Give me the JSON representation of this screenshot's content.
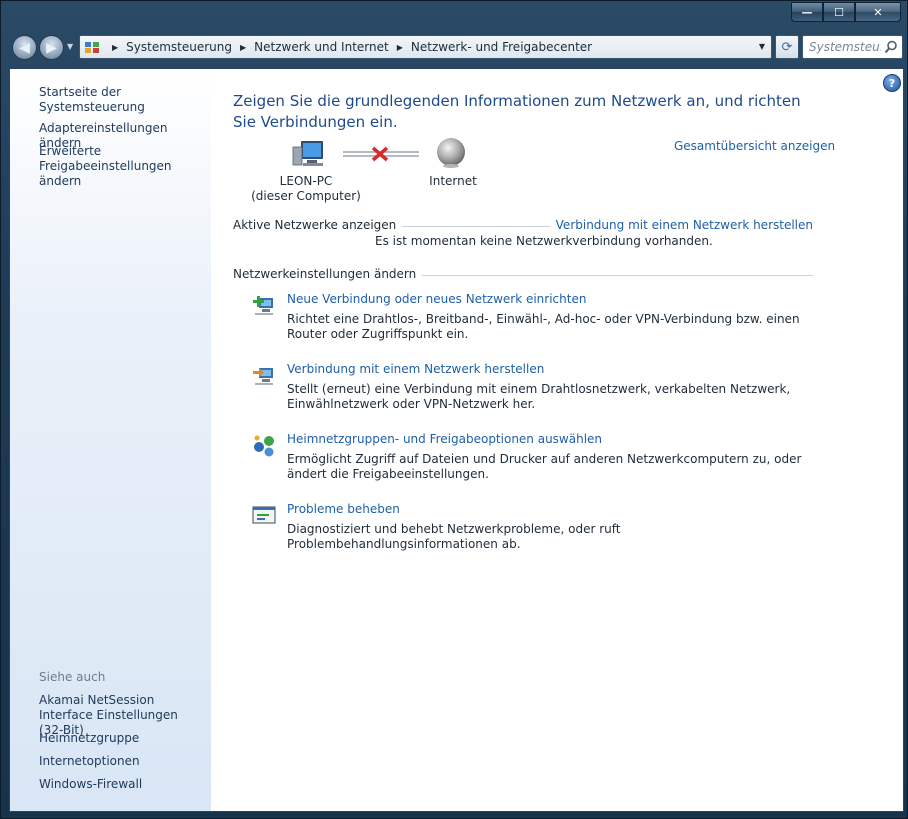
{
  "window": {
    "caption_buttons": {
      "minimize": "—",
      "maximize": "☐",
      "close": "✕"
    }
  },
  "toolbar": {
    "back_glyph": "◀",
    "forward_glyph": "▶",
    "breadcrumbs": [
      "Systemsteuerung",
      "Netzwerk und Internet",
      "Netzwerk- und Freigabecenter"
    ],
    "refresh_glyph": "⟳",
    "search_placeholder": "Systemsteu..."
  },
  "sidebar": {
    "home_link": "Startseite der Systemsteuerung",
    "links": [
      "Adaptereinstellungen ändern",
      "Erweiterte Freigabeeinstellungen ändern"
    ],
    "see_also_title": "Siehe auch",
    "see_also": [
      "Akamai NetSession Interface Einstellungen (32-Bit)",
      "Heimnetzgruppe",
      "Internetoptionen",
      "Windows-Firewall"
    ]
  },
  "main": {
    "title": "Zeigen Sie die grundlegenden Informationen zum Netzwerk an, und richten Sie Verbindungen ein.",
    "full_map_link": "Gesamtübersicht anzeigen",
    "map": {
      "computer_name": "LEON-PC",
      "computer_sub": "(dieser Computer)",
      "internet_label": "Internet"
    },
    "active_networks": {
      "label": "Aktive Netzwerke anzeigen",
      "connect_link": "Verbindung mit einem Netzwerk herstellen",
      "message": "Es ist momentan keine Netzwerkverbindung vorhanden."
    },
    "change_settings": {
      "label": "Netzwerkeinstellungen ändern",
      "tasks": [
        {
          "icon": "new-connection-icon",
          "link": "Neue Verbindung oder neues Netzwerk einrichten",
          "desc": "Richtet eine Drahtlos-, Breitband-, Einwähl-, Ad-hoc- oder VPN-Verbindung bzw. einen Router oder Zugriffspunkt ein."
        },
        {
          "icon": "connect-network-icon",
          "link": "Verbindung mit einem Netzwerk herstellen",
          "desc": "Stellt (erneut) eine Verbindung mit einem Drahtlosnetzwerk, verkabelten Netzwerk, Einwählnetzwerk oder VPN-Netzwerk her."
        },
        {
          "icon": "homegroup-icon",
          "link": "Heimnetzgruppen- und Freigabeoptionen auswählen",
          "desc": "Ermöglicht Zugriff auf Dateien und Drucker auf anderen Netzwerkcomputern zu, oder ändert die Freigabeeinstellungen."
        },
        {
          "icon": "troubleshoot-icon",
          "link": "Probleme beheben",
          "desc": "Diagnostiziert und behebt Netzwerkprobleme, oder ruft Problembehandlungsinformationen ab."
        }
      ]
    }
  },
  "colors": {
    "link": "#1e5fa8",
    "title": "#1e4a8c",
    "sidebar_link": "#1e395b",
    "frame": "#1d3a55"
  }
}
